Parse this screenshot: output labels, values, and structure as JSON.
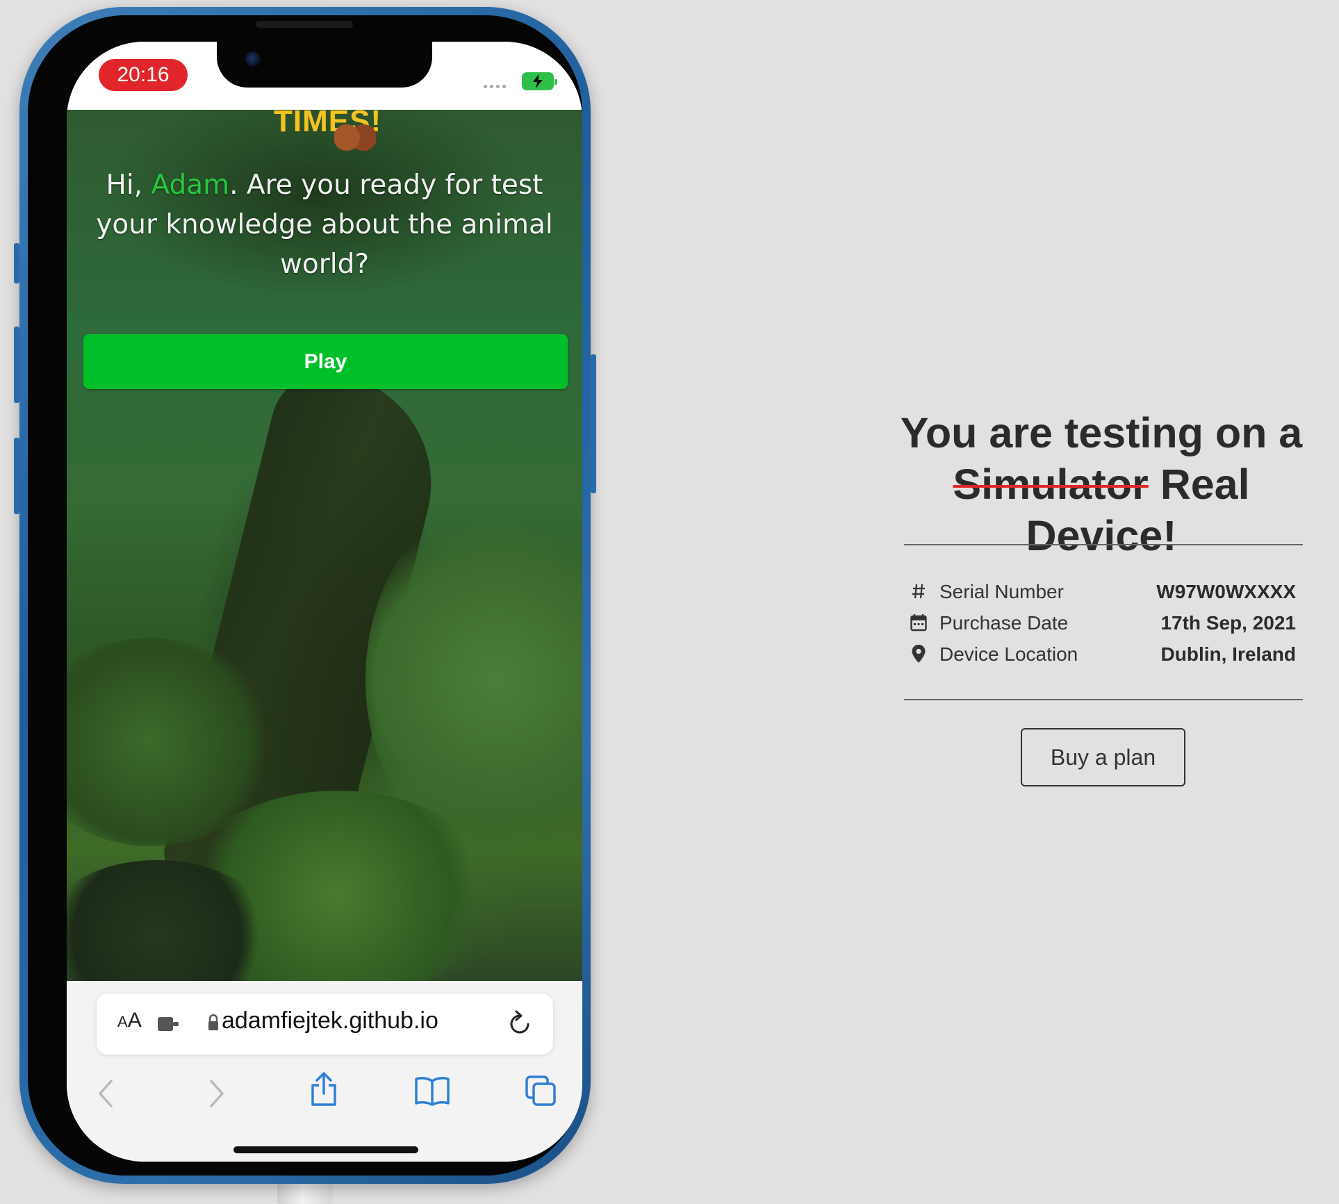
{
  "status_bar": {
    "time": "20:16"
  },
  "web_page": {
    "logo_text": "TIMES!",
    "greeting_prefix": "Hi, ",
    "user_name": "Adam",
    "greeting_suffix": ". Are you ready for test your knowledge about the animal world?",
    "play_label": "Play"
  },
  "safari": {
    "aa_small": "A",
    "aa_big": "A",
    "url": "adamfiejtek.github.io",
    "toolbar_icons": [
      "back-icon",
      "forward-icon",
      "share-icon",
      "bookmarks-icon",
      "tabs-icon"
    ],
    "accent_color": "#2f7fd6"
  },
  "panel": {
    "title_line1": "You are testing on a",
    "title_struck": "Simulator",
    "title_rest": " Real Device!",
    "strike_color": "#e0262b",
    "rows": [
      {
        "icon": "hash-icon",
        "label": "Serial Number",
        "value": "W97W0WXXXX"
      },
      {
        "icon": "calendar-icon",
        "label": "Purchase Date",
        "value": "17th Sep, 2021"
      },
      {
        "icon": "location-pin-icon",
        "label": "Device Location",
        "value": "Dublin, Ireland"
      }
    ],
    "buy_label": "Buy a plan"
  }
}
